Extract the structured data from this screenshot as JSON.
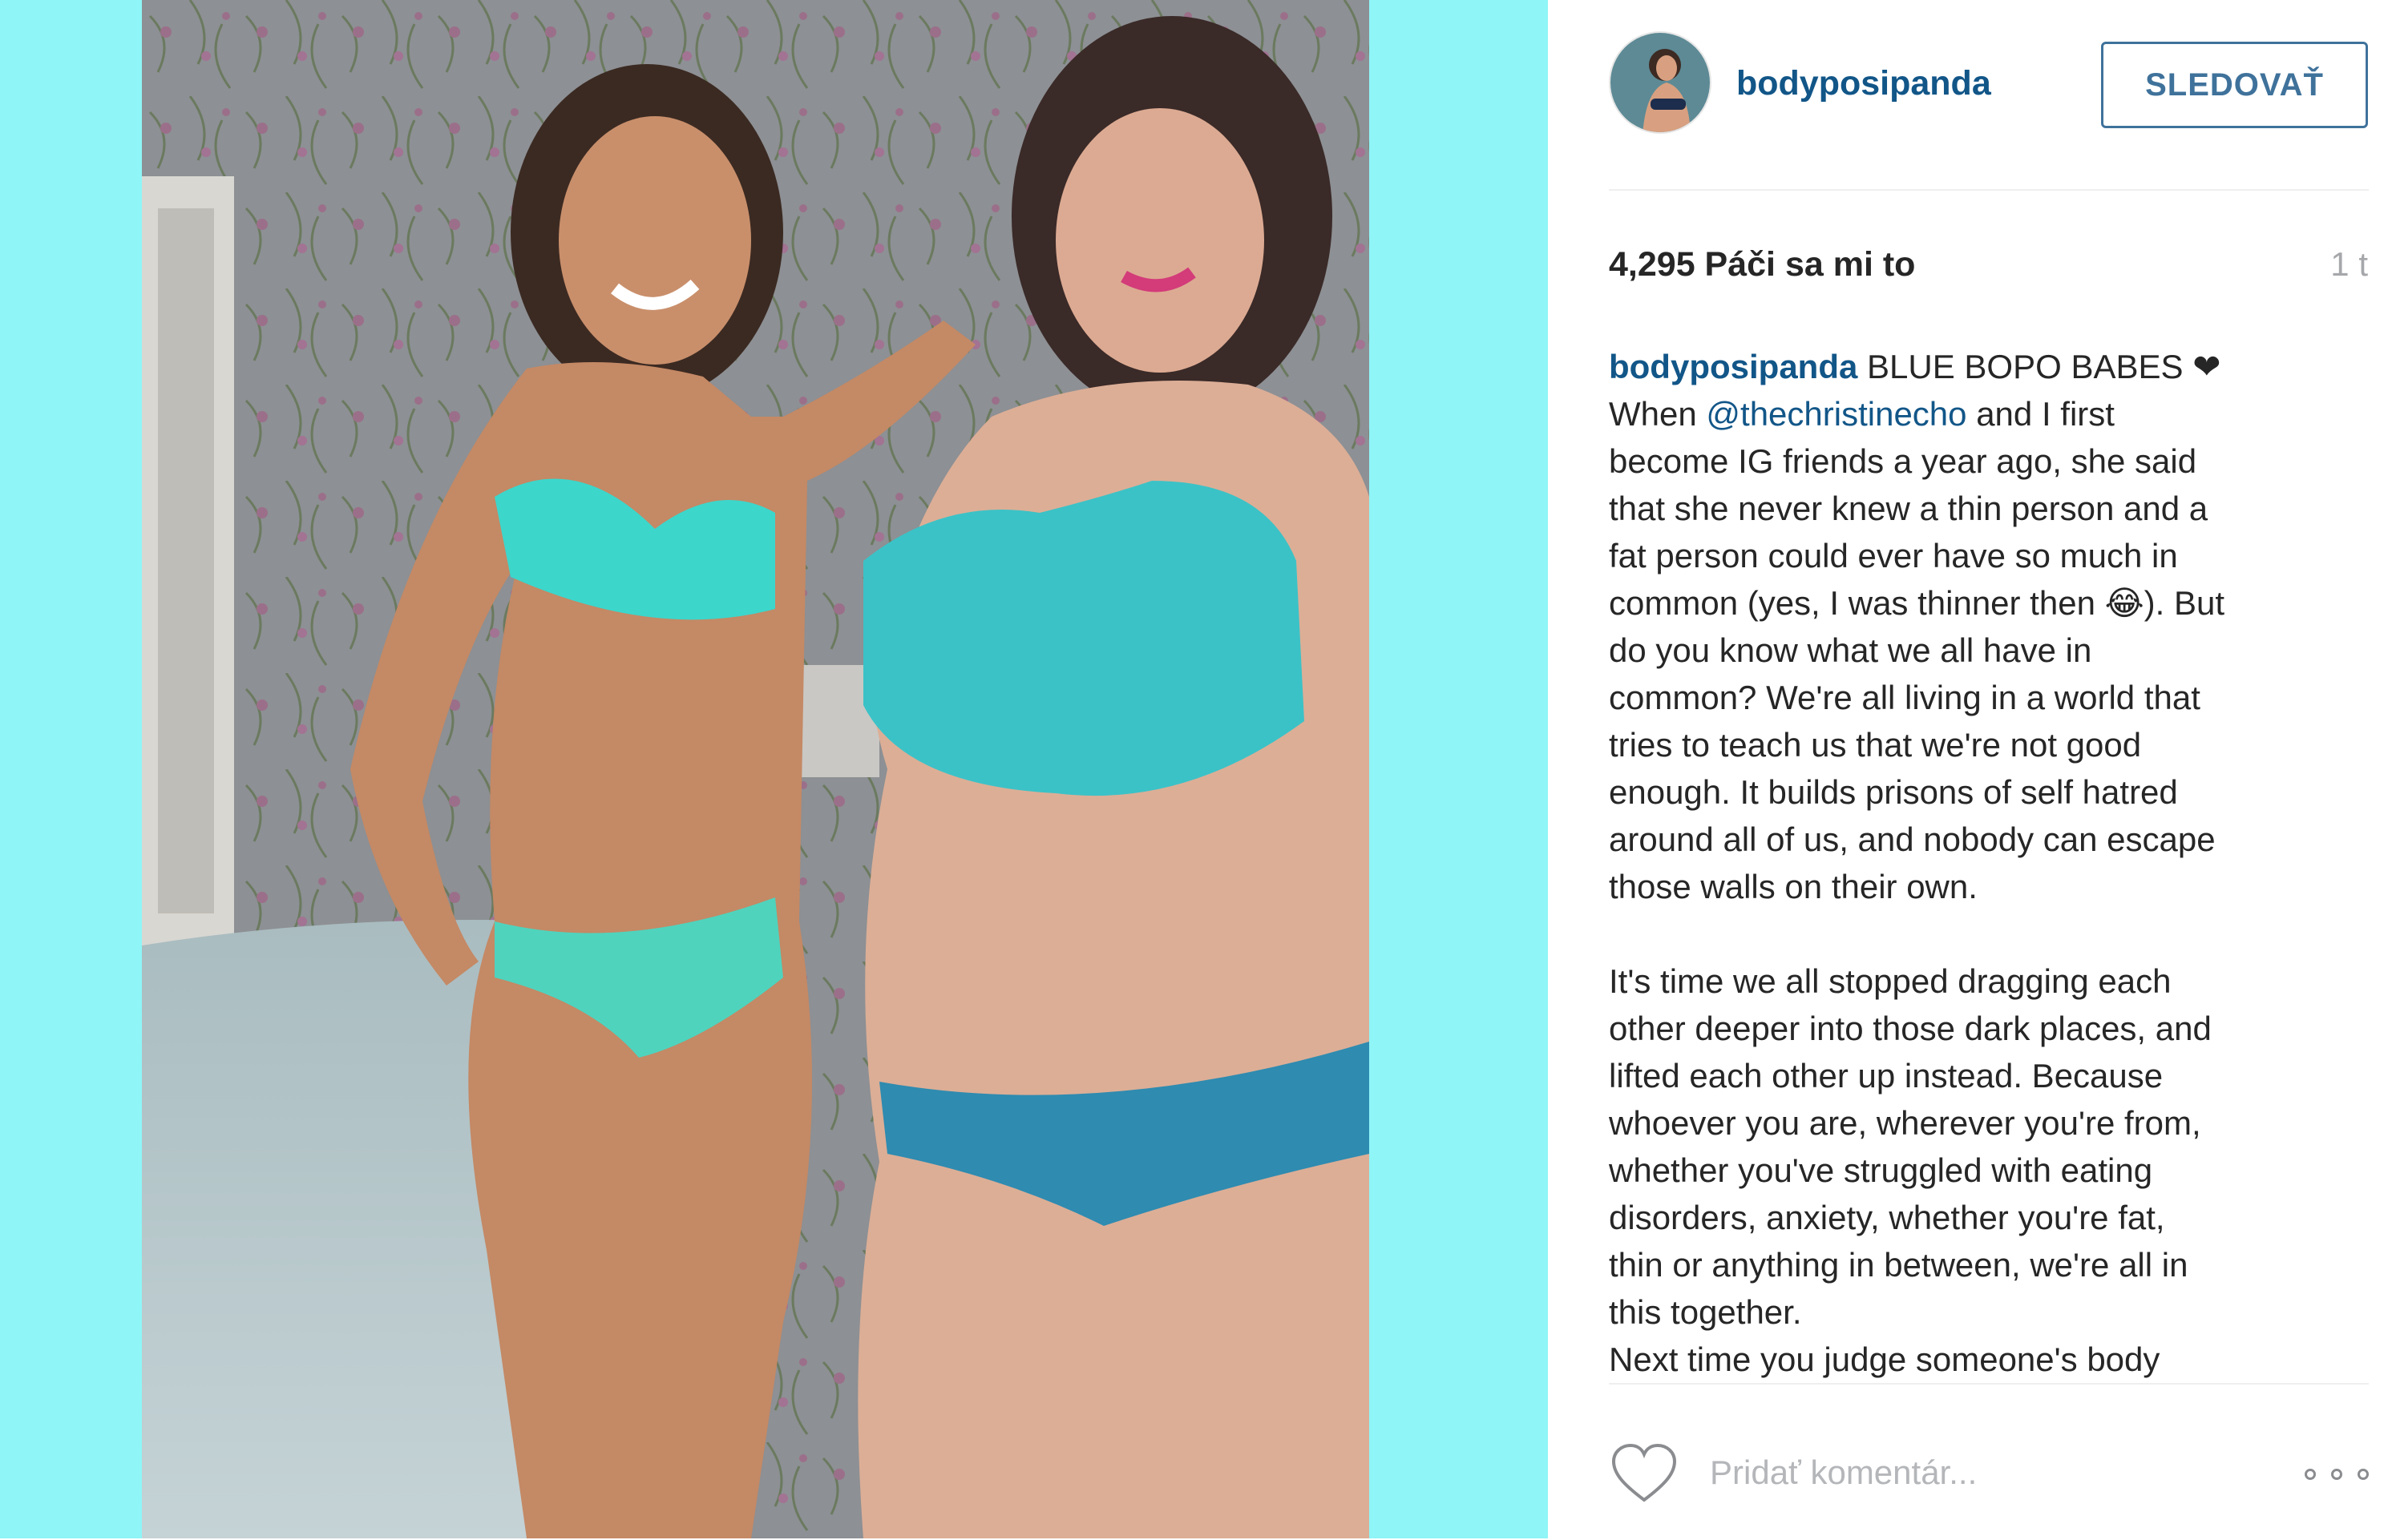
{
  "post": {
    "username": "bodyposipanda",
    "follow_label": "SLEDOVAŤ",
    "likes": "4,295 Páči sa mi to",
    "time": "1 t"
  },
  "caption": {
    "username": "bodyposipanda",
    "title": "BLUE BOPO BABES ❤",
    "line1_pre": "When ",
    "mention": "@thechristinecho",
    "line1_post": " and I first",
    "para1_rest": "become IG friends a year ago, she said\nthat she never knew a thin person and a\nfat person could ever have so much in\ncommon (yes, I was thinner then 😂). But\ndo you know what we all have in\ncommon? We're all living in a world that\ntries to teach us that we're not good\nenough. It builds prisons of self hatred\naround all of us, and nobody can escape\nthose walls on their own.",
    "para2": "It's time we all stopped dragging each\nother deeper into those dark places, and\nlifted each other up instead. Because\nwhoever you are, wherever you're from,\nwhether you've struggled with eating\ndisorders, anxiety, whether you're fat,\nthin or anything in between, we're all in\nthis together.\nNext time you judge someone's body"
  },
  "comment": {
    "placeholder": "Pridať komentár..."
  },
  "icons": {
    "like": "heart-outline-icon",
    "more": "more-options-icon"
  },
  "colors": {
    "background": "#8ff5f7",
    "link": "#125688",
    "button": "#3f729b",
    "text": "#262626",
    "muted": "#a5a7aa"
  }
}
